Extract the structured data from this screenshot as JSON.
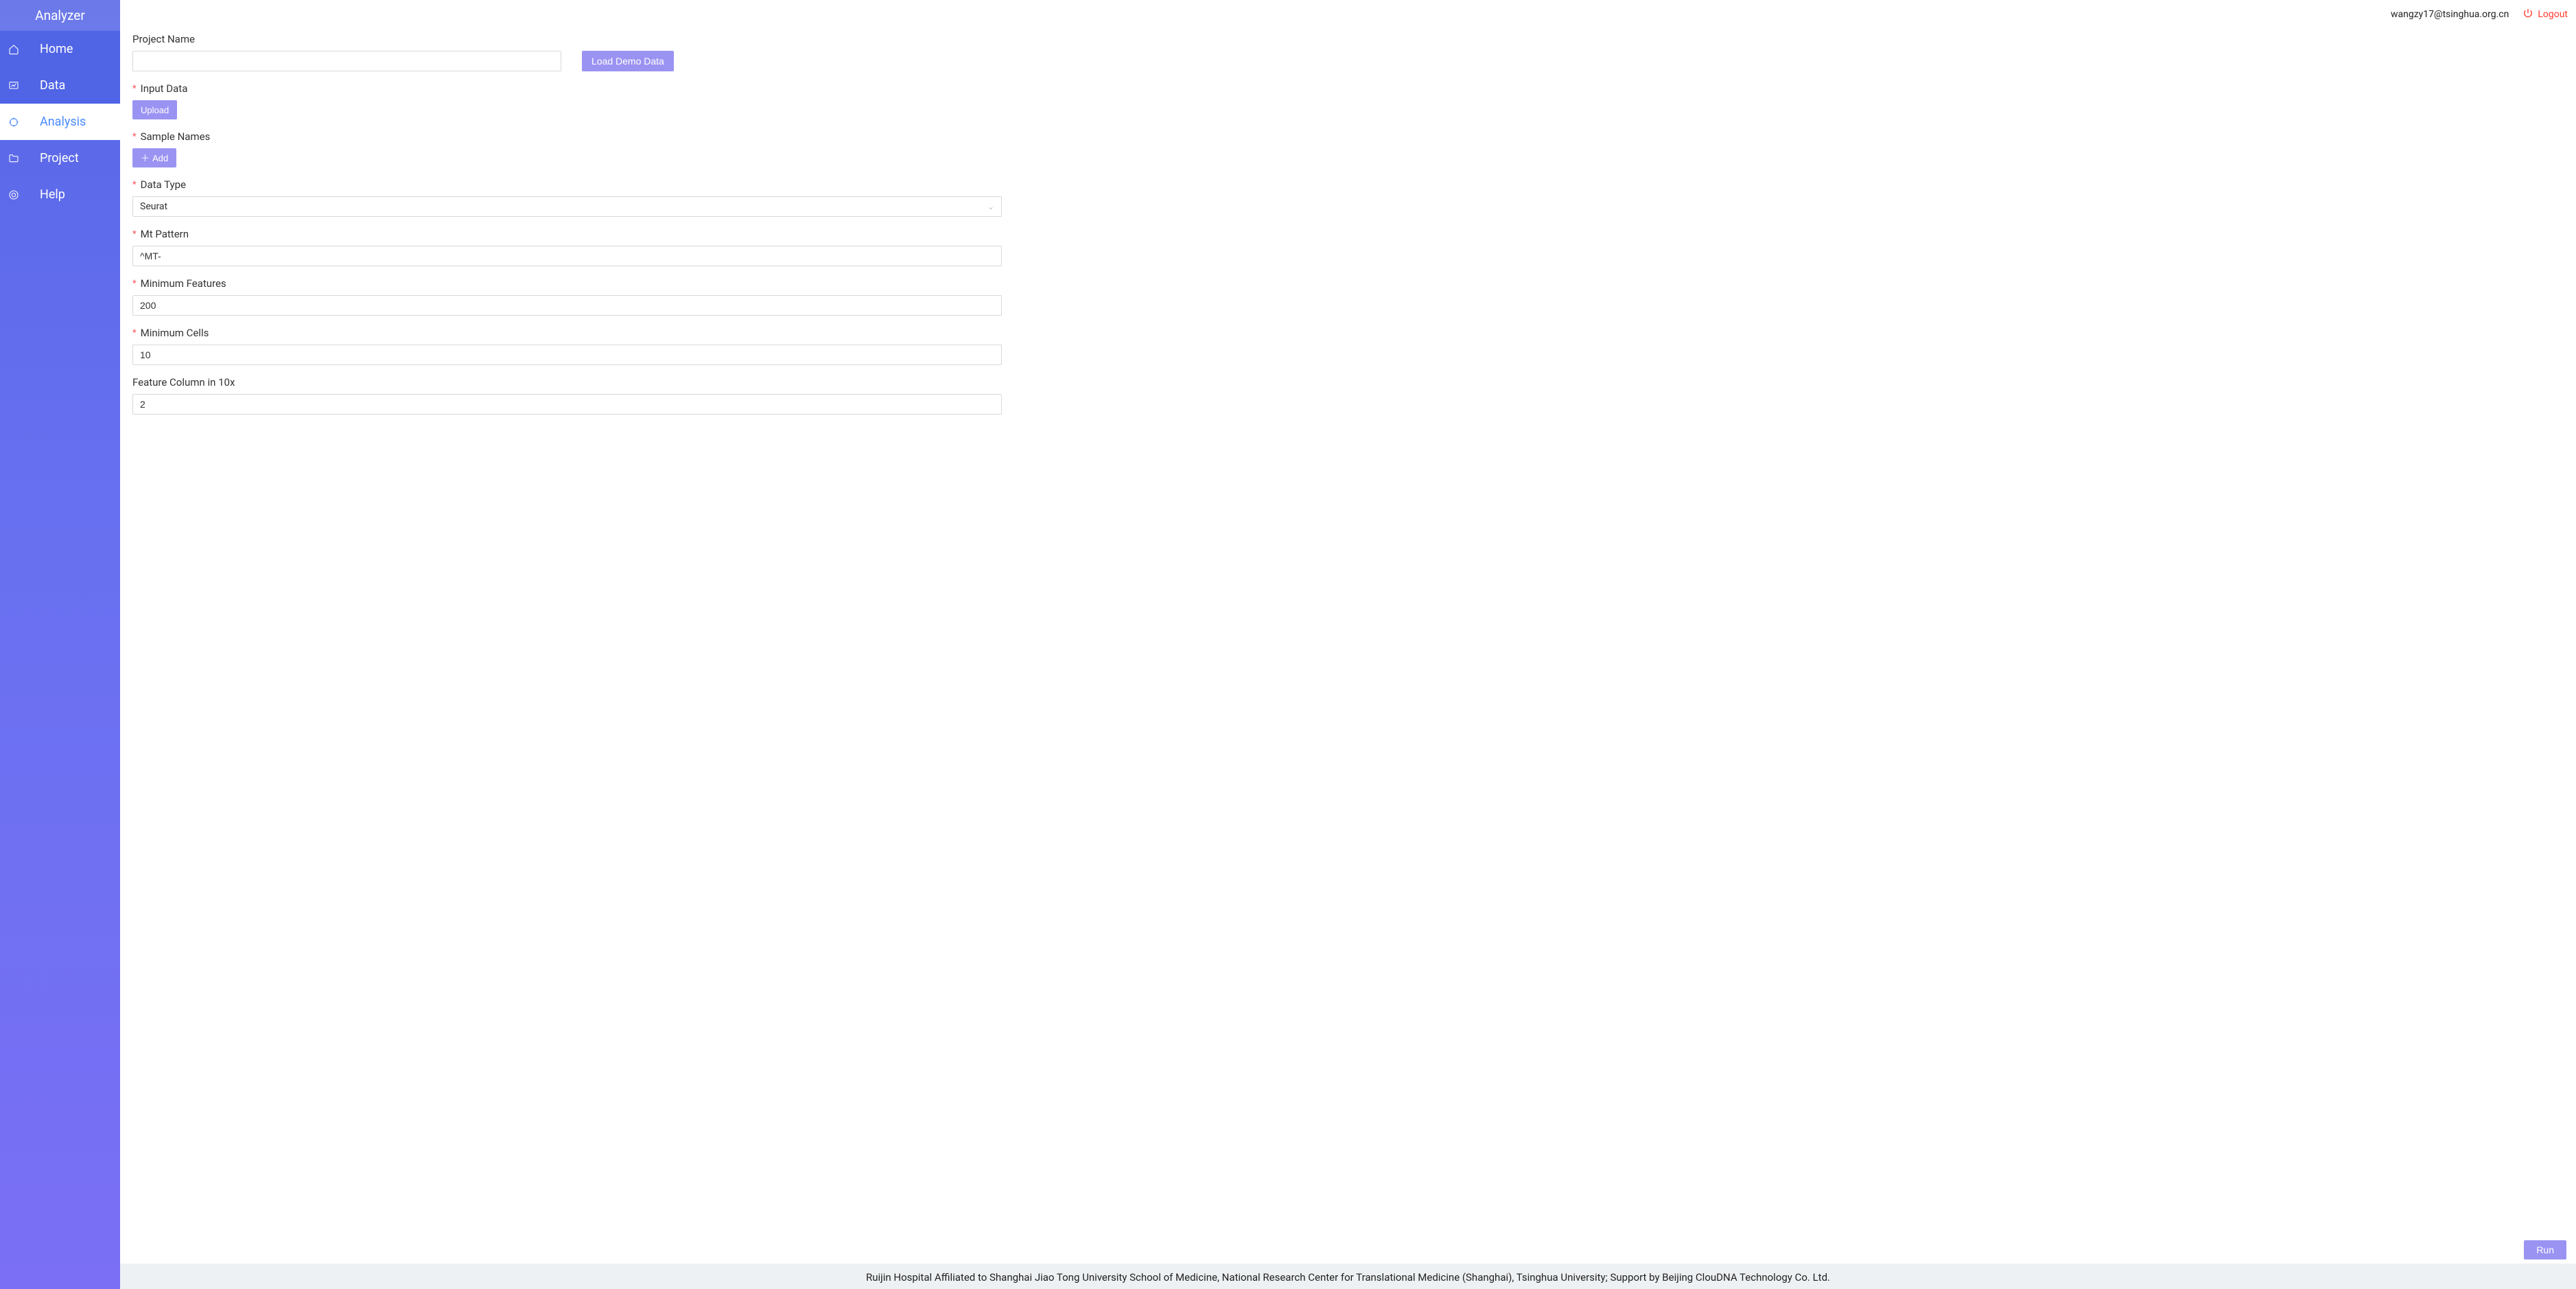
{
  "sidebar": {
    "logo": "Analyzer",
    "items": [
      {
        "label": "Home"
      },
      {
        "label": "Data"
      },
      {
        "label": "Analysis"
      },
      {
        "label": "Project"
      },
      {
        "label": "Help"
      }
    ]
  },
  "topbar": {
    "user_email": "wangzy17@tsinghua.org.cn",
    "logout_label": "Logout"
  },
  "form": {
    "project_name": {
      "label": "Project Name",
      "value": ""
    },
    "load_demo_label": "Load Demo Data",
    "input_data": {
      "label": "Input Data",
      "upload_label": "Upload"
    },
    "sample_names": {
      "label": "Sample Names",
      "add_label": "Add"
    },
    "data_type": {
      "label": "Data Type",
      "value": "Seurat"
    },
    "mt_pattern": {
      "label": "Mt Pattern",
      "value": "^MT-"
    },
    "min_features": {
      "label": "Minimum Features",
      "value": "200"
    },
    "min_cells": {
      "label": "Minimum Cells",
      "value": "10"
    },
    "feature_column": {
      "label": "Feature Column in 10x",
      "value": "2"
    },
    "run_label": "Run"
  },
  "footer": {
    "text": "Ruijin Hospital Affiliated to Shanghai Jiao Tong University School of Medicine, National Research Center for Translational Medicine (Shanghai), Tsinghua University; Support by Beijing ClouDNA Technology Co. Ltd."
  }
}
